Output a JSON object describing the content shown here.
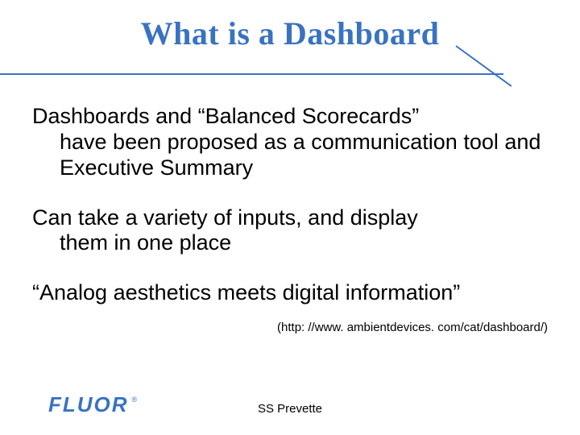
{
  "title": "What is a Dashboard",
  "paragraphs": {
    "p1_line1": "Dashboards and “Balanced Scorecards”",
    "p1_rest": "have been proposed as a communication tool and Executive Summary",
    "p2_line1": "Can take a variety of inputs, and display",
    "p2_rest": "them in one place",
    "p3": "“Analog aesthetics meets digital information”"
  },
  "citation": "(http: //www. ambientdevices. com/cat/dashboard/)",
  "logo": {
    "text": "FLUOR",
    "mark": "®"
  },
  "footer_author": "SS Prevette"
}
